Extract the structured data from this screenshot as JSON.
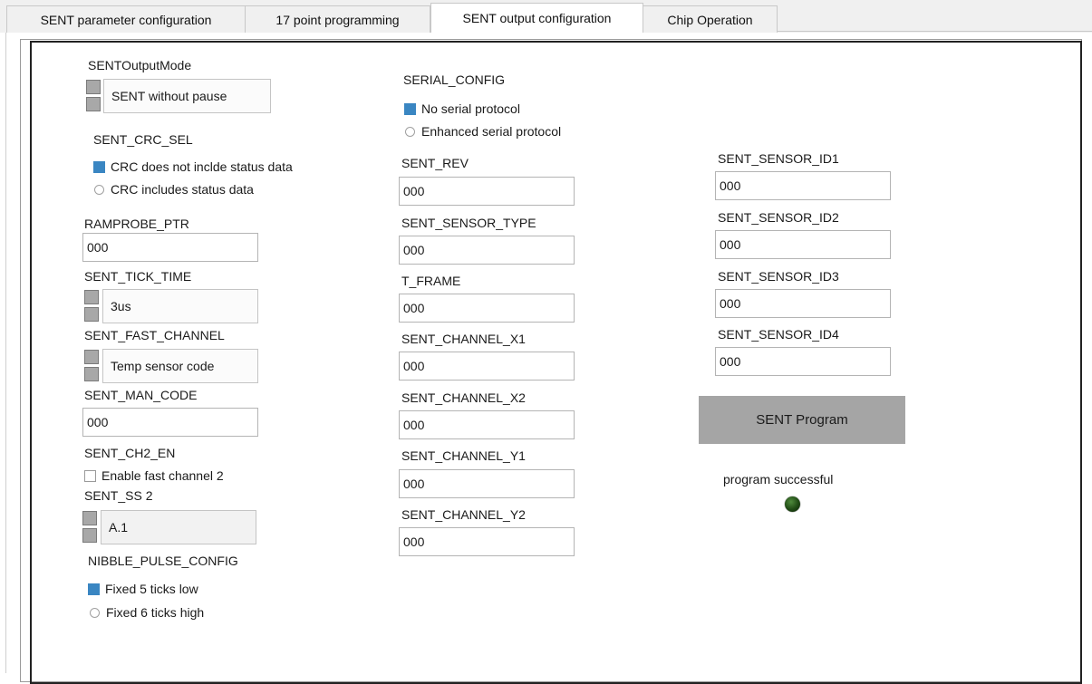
{
  "tabs": [
    {
      "label": "SENT parameter configuration",
      "active": false
    },
    {
      "label": "17 point programming",
      "active": false
    },
    {
      "label": "SENT output configuration",
      "active": true
    },
    {
      "label": "Chip Operation",
      "active": false
    }
  ],
  "col1": {
    "output_mode": {
      "label": "SENTOutputMode",
      "value": "SENT without pause"
    },
    "crc_sel": {
      "label": "SENT_CRC_SEL",
      "option1": "CRC does not inclde status data",
      "option2": "CRC includes status data",
      "selected": "option1"
    },
    "ramprobe_ptr": {
      "label": "RAMPROBE_PTR",
      "value": "000"
    },
    "tick_time": {
      "label": "SENT_TICK_TIME",
      "value": "3us"
    },
    "fast_channel": {
      "label": "SENT_FAST_CHANNEL",
      "value": "Temp sensor code"
    },
    "man_code": {
      "label": "SENT_MAN_CODE",
      "value": "000"
    },
    "ch2_en": {
      "label": "SENT_CH2_EN",
      "checkbox_label": "Enable fast channel 2",
      "checked": false
    },
    "ss2": {
      "label": "SENT_SS 2",
      "value": "A.1"
    },
    "nibble_pulse": {
      "label": "NIBBLE_PULSE_CONFIG",
      "option1": "Fixed 5 ticks low",
      "option2": "Fixed 6 ticks high",
      "selected": "option1"
    }
  },
  "col2": {
    "serial_config": {
      "label": "SERIAL_CONFIG",
      "option1": "No serial protocol",
      "option2": "Enhanced serial protocol",
      "selected": "option1"
    },
    "sent_rev": {
      "label": "SENT_REV",
      "value": "000"
    },
    "sensor_type": {
      "label": "SENT_SENSOR_TYPE",
      "value": "000"
    },
    "t_frame": {
      "label": "T_FRAME",
      "value": "000"
    },
    "channel_x1": {
      "label": "SENT_CHANNEL_X1",
      "value": "000"
    },
    "channel_x2": {
      "label": "SENT_CHANNEL_X2",
      "value": "000"
    },
    "channel_y1": {
      "label": "SENT_CHANNEL_Y1",
      "value": "000"
    },
    "channel_y2": {
      "label": "SENT_CHANNEL_Y2",
      "value": "000"
    }
  },
  "col3": {
    "sensor_id1": {
      "label": "SENT_SENSOR_ID1",
      "value": "000"
    },
    "sensor_id2": {
      "label": "SENT_SENSOR_ID2",
      "value": "000"
    },
    "sensor_id3": {
      "label": "SENT_SENSOR_ID3",
      "value": "000"
    },
    "sensor_id4": {
      "label": "SENT_SENSOR_ID4",
      "value": "000"
    },
    "program_button": "SENT Program",
    "status_label": "program successful",
    "led_state": "on-dark-green"
  },
  "colors": {
    "accent_blue": "#3a86c2",
    "button_gray": "#a5a5a5",
    "led_green": "#1f4a14"
  }
}
